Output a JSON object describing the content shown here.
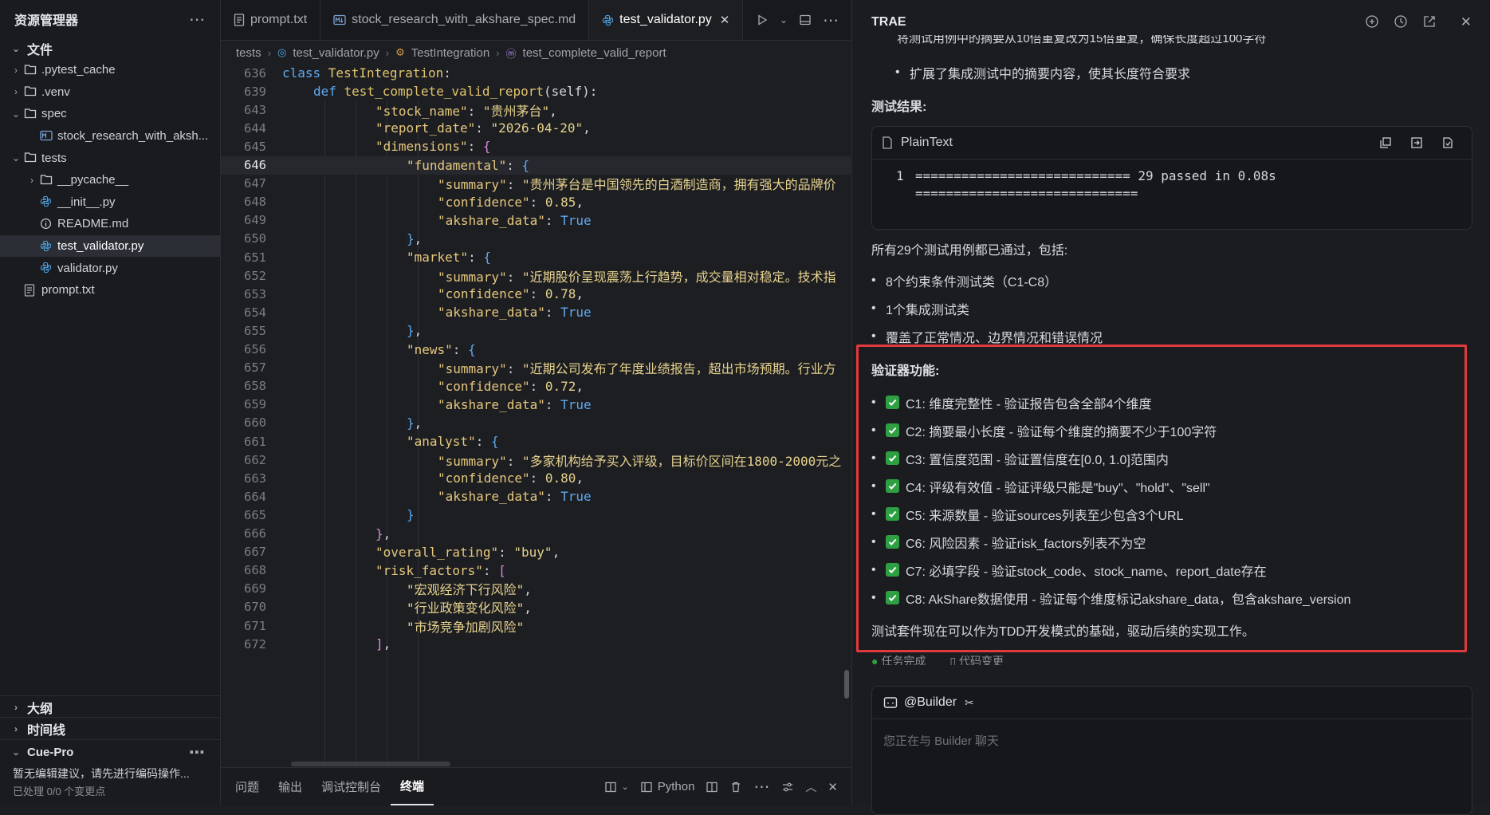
{
  "sidebar": {
    "title": "资源管理器",
    "files_section": "文件",
    "tree": [
      {
        "label": ".pytest_cache",
        "type": "folder",
        "indent": 1,
        "arrow": "›"
      },
      {
        "label": ".venv",
        "type": "folder",
        "indent": 1,
        "arrow": "›"
      },
      {
        "label": "spec",
        "type": "folder",
        "indent": 1,
        "arrow": "⌄"
      },
      {
        "label": "stock_research_with_aksh...",
        "type": "md",
        "indent": 2,
        "arrow": ""
      },
      {
        "label": "tests",
        "type": "folder",
        "indent": 1,
        "arrow": "⌄"
      },
      {
        "label": "__pycache__",
        "type": "folder",
        "indent": 2,
        "arrow": "›"
      },
      {
        "label": "__init__.py",
        "type": "py",
        "indent": 2,
        "arrow": ""
      },
      {
        "label": "README.md",
        "type": "info",
        "indent": 2,
        "arrow": ""
      },
      {
        "label": "test_validator.py",
        "type": "py",
        "indent": 2,
        "arrow": "",
        "active": true
      },
      {
        "label": "validator.py",
        "type": "py",
        "indent": 2,
        "arrow": ""
      },
      {
        "label": "prompt.txt",
        "type": "txt",
        "indent": 1,
        "arrow": ""
      }
    ],
    "outline": "大纲",
    "timeline": "时间线",
    "cue_pro": "Cue-Pro",
    "cue_msg": "暂无编辑建议，请先进行编码操作...",
    "cue_more": "已处理 0/0 个变更点"
  },
  "editor": {
    "tabs": [
      {
        "label": "prompt.txt",
        "icon": "txt"
      },
      {
        "label": "stock_research_with_akshare_spec.md",
        "icon": "md"
      },
      {
        "label": "test_validator.py",
        "icon": "py",
        "active": true,
        "close": "✕"
      }
    ],
    "breadcrumb": [
      "tests",
      "test_validator.py",
      "TestIntegration",
      "test_complete_valid_report"
    ],
    "bottom_tabs": [
      "问题",
      "输出",
      "调试控制台",
      "终端"
    ],
    "language": "Python",
    "lines": [
      {
        "n": "636",
        "indent": 0,
        "tokens": [
          [
            "k",
            "class "
          ],
          [
            "cls",
            "TestIntegration"
          ],
          [
            "p",
            ":"
          ]
        ],
        "sticky": true
      },
      {
        "n": "639",
        "indent": 1,
        "tokens": [
          [
            "k",
            "def "
          ],
          [
            "fn",
            "test_complete_valid_report"
          ],
          [
            "p",
            "(self):"
          ]
        ],
        "sticky": true
      },
      {
        "n": "643",
        "indent": 3,
        "tokens": [
          [
            "s",
            "\"stock_name\""
          ],
          [
            "p",
            ": "
          ],
          [
            "str",
            "\"贵州茅台\""
          ],
          [
            "p",
            ","
          ]
        ]
      },
      {
        "n": "644",
        "indent": 3,
        "tokens": [
          [
            "s",
            "\"report_date\""
          ],
          [
            "p",
            ": "
          ],
          [
            "str",
            "\"2026-04-20\""
          ],
          [
            "p",
            ","
          ]
        ]
      },
      {
        "n": "645",
        "indent": 3,
        "tokens": [
          [
            "s",
            "\"dimensions\""
          ],
          [
            "p",
            ": "
          ],
          [
            "br3",
            "{"
          ]
        ]
      },
      {
        "n": "646",
        "indent": 4,
        "tokens": [
          [
            "s",
            "\"fundamental\""
          ],
          [
            "p",
            ": "
          ],
          [
            "br2",
            "{"
          ]
        ],
        "current": true
      },
      {
        "n": "647",
        "indent": 5,
        "tokens": [
          [
            "s",
            "\"summary\""
          ],
          [
            "p",
            ": "
          ],
          [
            "str",
            "\"贵州茅台是中国领先的白酒制造商，拥有强大的品牌价"
          ]
        ]
      },
      {
        "n": "648",
        "indent": 5,
        "tokens": [
          [
            "s",
            "\"confidence\""
          ],
          [
            "p",
            ": "
          ],
          [
            "num",
            "0.85"
          ],
          [
            "p",
            ","
          ]
        ]
      },
      {
        "n": "649",
        "indent": 5,
        "tokens": [
          [
            "s",
            "\"akshare_data\""
          ],
          [
            "p",
            ": "
          ],
          [
            "tru",
            "True"
          ]
        ]
      },
      {
        "n": "650",
        "indent": 4,
        "tokens": [
          [
            "br2",
            "}"
          ],
          [
            "p",
            ","
          ]
        ]
      },
      {
        "n": "651",
        "indent": 4,
        "tokens": [
          [
            "s",
            "\"market\""
          ],
          [
            "p",
            ": "
          ],
          [
            "br2",
            "{"
          ]
        ]
      },
      {
        "n": "652",
        "indent": 5,
        "tokens": [
          [
            "s",
            "\"summary\""
          ],
          [
            "p",
            ": "
          ],
          [
            "str",
            "\"近期股价呈现震荡上行趋势，成交量相对稳定。技术指"
          ]
        ]
      },
      {
        "n": "653",
        "indent": 5,
        "tokens": [
          [
            "s",
            "\"confidence\""
          ],
          [
            "p",
            ": "
          ],
          [
            "num",
            "0.78"
          ],
          [
            "p",
            ","
          ]
        ]
      },
      {
        "n": "654",
        "indent": 5,
        "tokens": [
          [
            "s",
            "\"akshare_data\""
          ],
          [
            "p",
            ": "
          ],
          [
            "tru",
            "True"
          ]
        ]
      },
      {
        "n": "655",
        "indent": 4,
        "tokens": [
          [
            "br2",
            "}"
          ],
          [
            "p",
            ","
          ]
        ]
      },
      {
        "n": "656",
        "indent": 4,
        "tokens": [
          [
            "s",
            "\"news\""
          ],
          [
            "p",
            ": "
          ],
          [
            "br2",
            "{"
          ]
        ]
      },
      {
        "n": "657",
        "indent": 5,
        "tokens": [
          [
            "s",
            "\"summary\""
          ],
          [
            "p",
            ": "
          ],
          [
            "str",
            "\"近期公司发布了年度业绩报告，超出市场预期。行业方"
          ]
        ]
      },
      {
        "n": "658",
        "indent": 5,
        "tokens": [
          [
            "s",
            "\"confidence\""
          ],
          [
            "p",
            ": "
          ],
          [
            "num",
            "0.72"
          ],
          [
            "p",
            ","
          ]
        ]
      },
      {
        "n": "659",
        "indent": 5,
        "tokens": [
          [
            "s",
            "\"akshare_data\""
          ],
          [
            "p",
            ": "
          ],
          [
            "tru",
            "True"
          ]
        ]
      },
      {
        "n": "660",
        "indent": 4,
        "tokens": [
          [
            "br2",
            "}"
          ],
          [
            "p",
            ","
          ]
        ]
      },
      {
        "n": "661",
        "indent": 4,
        "tokens": [
          [
            "s",
            "\"analyst\""
          ],
          [
            "p",
            ": "
          ],
          [
            "br2",
            "{"
          ]
        ]
      },
      {
        "n": "662",
        "indent": 5,
        "tokens": [
          [
            "s",
            "\"summary\""
          ],
          [
            "p",
            ": "
          ],
          [
            "str",
            "\"多家机构给予买入评级，目标价区间在1800-2000元之"
          ]
        ]
      },
      {
        "n": "663",
        "indent": 5,
        "tokens": [
          [
            "s",
            "\"confidence\""
          ],
          [
            "p",
            ": "
          ],
          [
            "num",
            "0.80"
          ],
          [
            "p",
            ","
          ]
        ]
      },
      {
        "n": "664",
        "indent": 5,
        "tokens": [
          [
            "s",
            "\"akshare_data\""
          ],
          [
            "p",
            ": "
          ],
          [
            "tru",
            "True"
          ]
        ]
      },
      {
        "n": "665",
        "indent": 4,
        "tokens": [
          [
            "br2",
            "}"
          ]
        ]
      },
      {
        "n": "666",
        "indent": 3,
        "tokens": [
          [
            "br3",
            "}"
          ],
          [
            "p",
            ","
          ]
        ]
      },
      {
        "n": "667",
        "indent": 3,
        "tokens": [
          [
            "s",
            "\"overall_rating\""
          ],
          [
            "p",
            ": "
          ],
          [
            "str",
            "\"buy\""
          ],
          [
            "p",
            ","
          ]
        ]
      },
      {
        "n": "668",
        "indent": 3,
        "tokens": [
          [
            "s",
            "\"risk_factors\""
          ],
          [
            "p",
            ": "
          ],
          [
            "br3",
            "["
          ]
        ]
      },
      {
        "n": "669",
        "indent": 4,
        "tokens": [
          [
            "str",
            "\"宏观经济下行风险\""
          ],
          [
            "p",
            ","
          ]
        ]
      },
      {
        "n": "670",
        "indent": 4,
        "tokens": [
          [
            "str",
            "\"行业政策变化风险\""
          ],
          [
            "p",
            ","
          ]
        ]
      },
      {
        "n": "671",
        "indent": 4,
        "tokens": [
          [
            "str",
            "\"市场竞争加剧风险\""
          ]
        ]
      },
      {
        "n": "672",
        "indent": 3,
        "tokens": [
          [
            "br3",
            "]"
          ],
          [
            "p",
            ","
          ]
        ]
      }
    ]
  },
  "chat": {
    "title": "TRAE",
    "cut_top": "将测试用例中的摘要从10倍重复改为15倍重复，确保长度超过100字符",
    "bullet_top": "扩展了集成测试中的摘要内容，使其长度符合要求",
    "result_heading": "测试结果:",
    "code_lang": "PlainText",
    "code_line_no": "1",
    "code_line1": "============================ 29 passed in 0.08s",
    "code_line2": "=============================",
    "summary": "所有29个测试用例都已通过，包括:",
    "summary_items": [
      "8个约束条件测试类（C1-C8）",
      "1个集成测试类",
      "覆盖了正常情况、边界情况和错误情况"
    ],
    "validator_heading": "验证器功能:",
    "validator_items": [
      "C1: 维度完整性 - 验证报告包含全部4个维度",
      "C2: 摘要最小长度 - 验证每个维度的摘要不少于100字符",
      "C3: 置信度范围 - 验证置信度在[0.0, 1.0]范围内",
      "C4: 评级有效值 - 验证评级只能是\"buy\"、\"hold\"、\"sell\"",
      "C5: 来源数量 - 验证sources列表至少包含3个URL",
      "C6: 风险因素 - 验证risk_factors列表不为空",
      "C7: 必填字段 - 验证stock_code、stock_name、report_date存在",
      "C8: AkShare数据使用 - 验证每个维度标记akshare_data，包含akshare_version"
    ],
    "closing": "测试套件现在可以作为TDD开发模式的基础，驱动后续的实现工作。",
    "status_done": "任务完成",
    "status_changes": "代码变更",
    "builder_label": "@Builder",
    "input_placeholder": "您正在与 Builder 聊天"
  }
}
